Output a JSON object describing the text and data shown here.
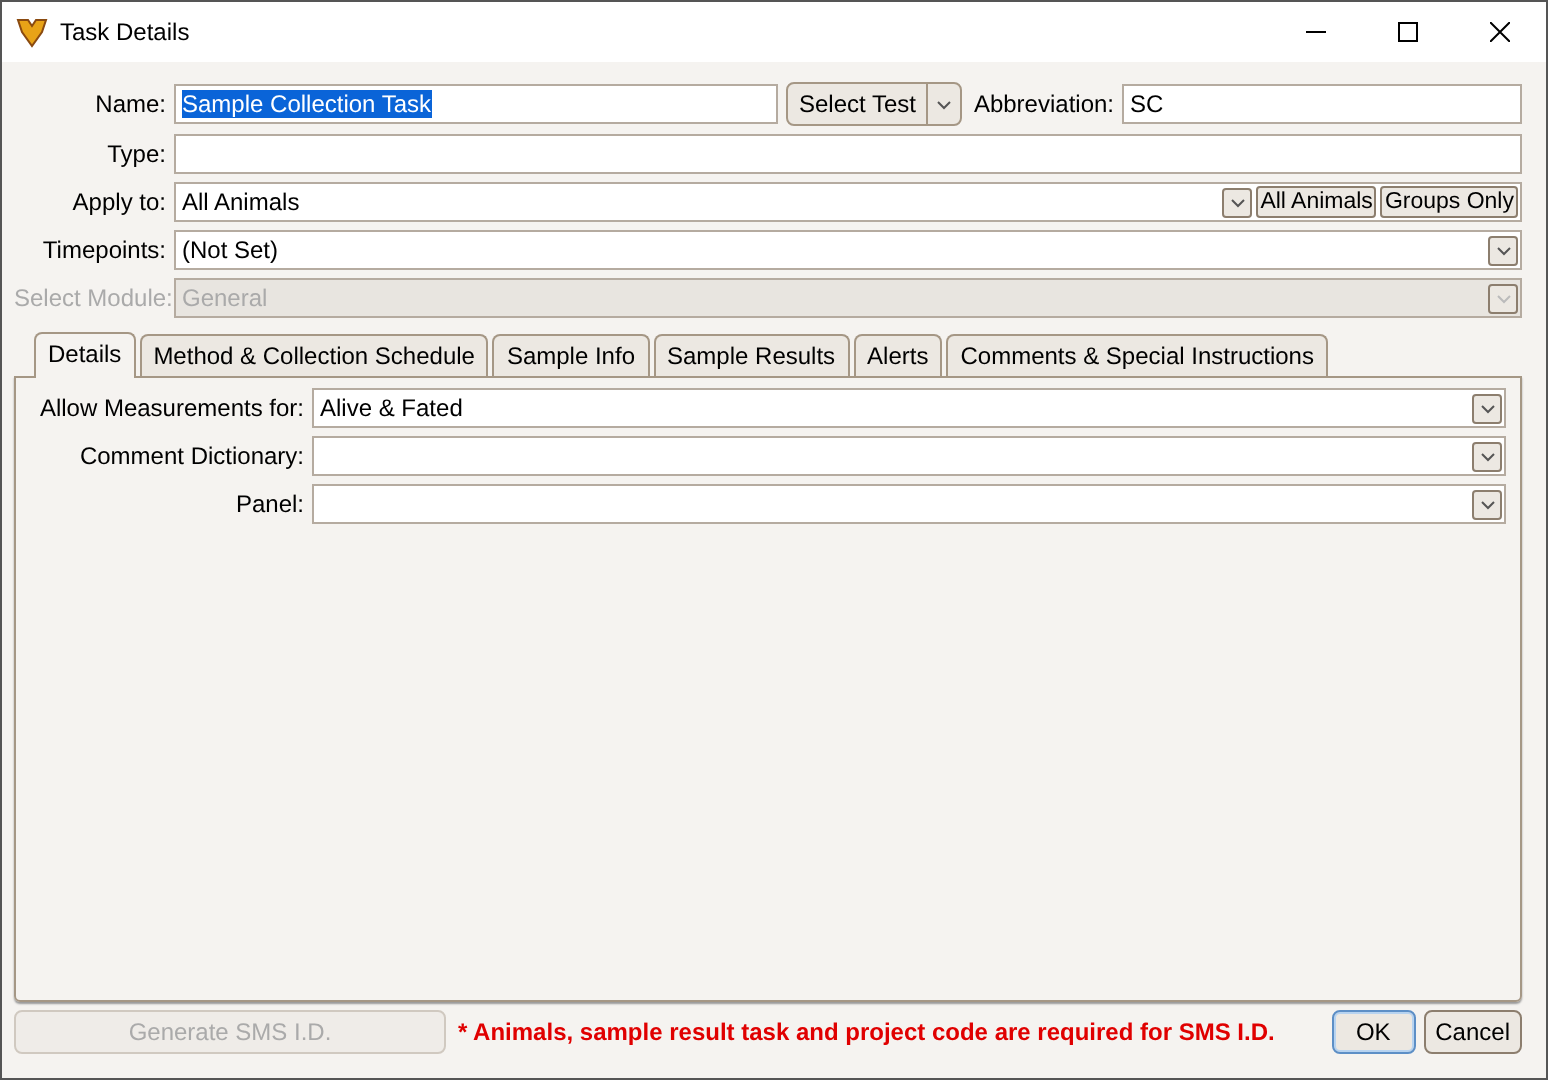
{
  "window": {
    "title": "Task Details"
  },
  "form": {
    "name": {
      "label": "Name:",
      "value": "Sample Collection Task",
      "text_selected": true
    },
    "select_test": {
      "label": "Select Test"
    },
    "abbreviation": {
      "label": "Abbreviation:",
      "value": "SC"
    },
    "type": {
      "label": "Type:"
    },
    "apply_to": {
      "label": "Apply to:",
      "value": "All Animals",
      "buttons": [
        "All Animals",
        "Groups Only"
      ]
    },
    "timepoints": {
      "label": "Timepoints:",
      "value": "(Not Set)"
    },
    "select_module": {
      "label": "Select Module:",
      "value": "General",
      "disabled": true
    }
  },
  "tabs": [
    {
      "label": "Details",
      "selected": true
    },
    {
      "label": "Method & Collection Schedule",
      "selected": false
    },
    {
      "label": "Sample Info",
      "selected": false
    },
    {
      "label": "Sample Results",
      "selected": false
    },
    {
      "label": "Alerts",
      "selected": false
    },
    {
      "label": "Comments & Special Instructions",
      "selected": false
    }
  ],
  "details": [
    {
      "label": "Allow Measurements for:",
      "value": "Alive & Fated"
    },
    {
      "label": "Comment Dictionary:"
    },
    {
      "label": "Panel:"
    }
  ],
  "footer": {
    "generate_button": {
      "label": "Generate SMS I.D.",
      "disabled": true
    },
    "note": "* Animals, sample result task and project code are required for SMS I.D.",
    "ok": "OK",
    "cancel": "Cancel"
  }
}
